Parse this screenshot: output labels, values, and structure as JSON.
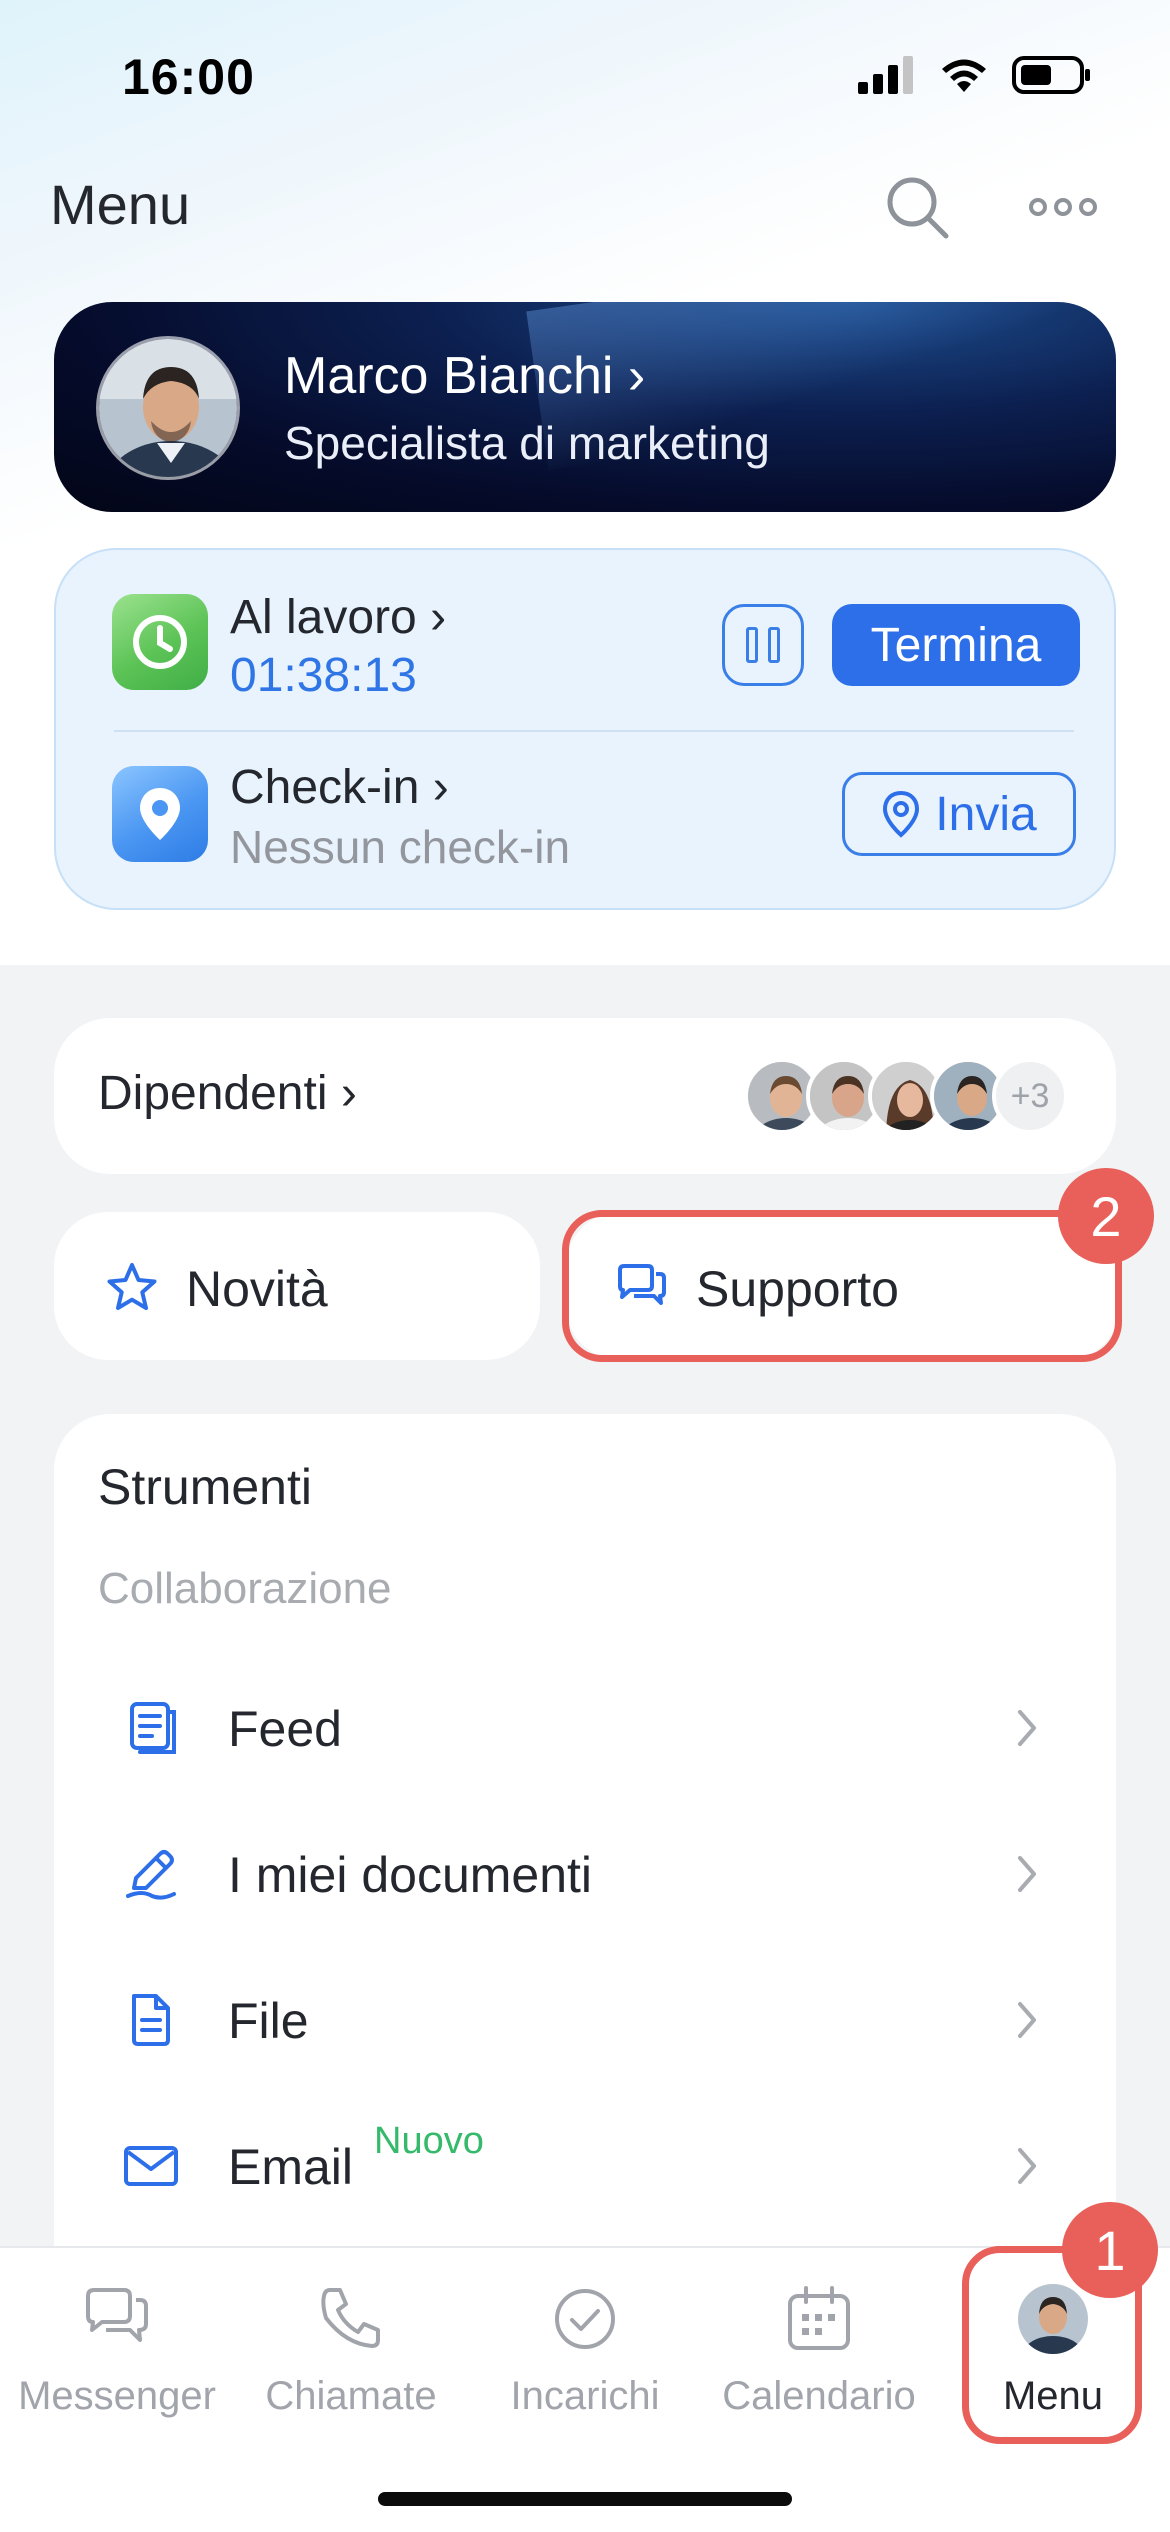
{
  "status_bar": {
    "time": "16:00"
  },
  "header": {
    "title": "Menu"
  },
  "profile": {
    "name": "Marco Bianchi",
    "chevron": "›",
    "role": "Specialista di marketing"
  },
  "work_status": {
    "title": "Al lavoro",
    "chevron": "›",
    "timer": "01:38:13",
    "stop_label": "Termina",
    "checkin_title": "Check-in",
    "checkin_subtitle": "Nessun check-in",
    "send_label": "Invia"
  },
  "employees": {
    "label": "Dipendenti",
    "chevron": "›",
    "more_count": "+3"
  },
  "quick_links": {
    "news_label": "Novità",
    "support_label": "Supporto"
  },
  "tools": {
    "title": "Strumenti",
    "section": "Collaborazione",
    "items": [
      {
        "label": "Feed",
        "icon": "feed-icon"
      },
      {
        "label": "I miei documenti",
        "icon": "pen-icon"
      },
      {
        "label": "File",
        "icon": "file-icon"
      },
      {
        "label": "Email",
        "icon": "mail-icon",
        "tag": "Nuovo"
      }
    ]
  },
  "tab_bar": {
    "items": [
      {
        "label": "Messenger"
      },
      {
        "label": "Chiamate"
      },
      {
        "label": "Incarichi"
      },
      {
        "label": "Calendario"
      },
      {
        "label": "Menu"
      }
    ]
  },
  "annotations": {
    "badge_1": "1",
    "badge_2": "2"
  },
  "colors": {
    "accent": "#2d6fe8",
    "highlight": "#e9605a",
    "new_tag": "#35b96a"
  }
}
